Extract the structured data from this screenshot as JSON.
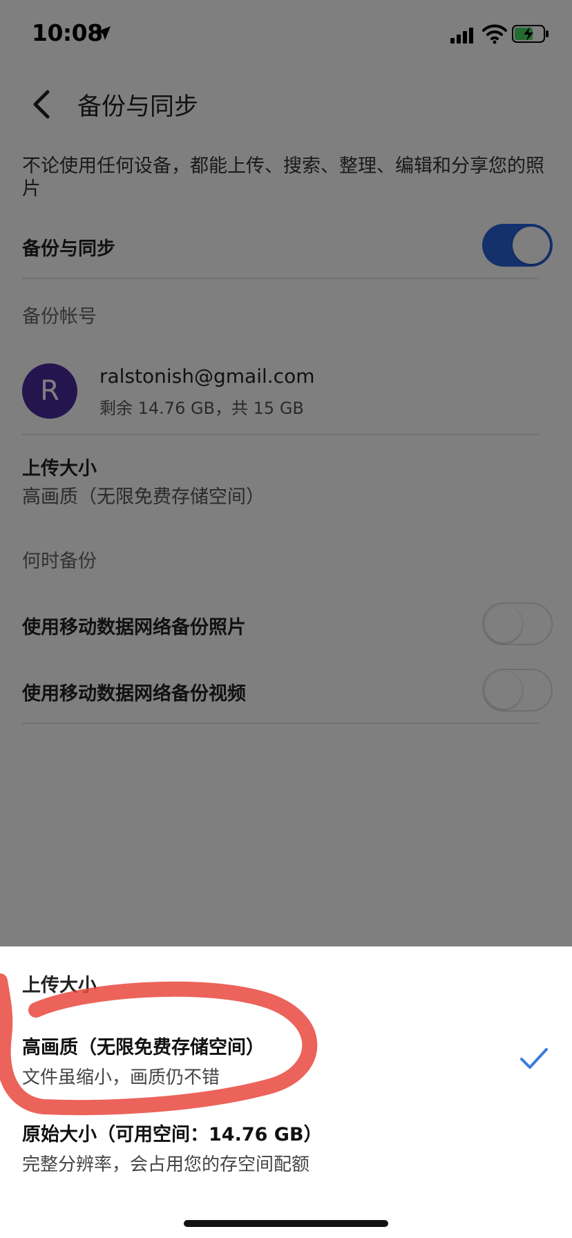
{
  "status_bar": {
    "time": "10:08"
  },
  "header": {
    "title": "备份与同步"
  },
  "description": "不论使用任何设备，都能上传、搜索、整理、编辑和分享您的照片",
  "backup_sync": {
    "label": "备份与同步",
    "enabled": true
  },
  "backup_account": {
    "section_label": "备份帐号",
    "avatar_letter": "R",
    "avatar_color": "#4a2a9e",
    "email": "ralstonish@gmail.com",
    "storage": "剩余 14.76 GB，共 15 GB"
  },
  "upload_size": {
    "label": "上传大小",
    "value": "高画质（无限免费存储空间）"
  },
  "when_backup": {
    "section_label": "何时备份",
    "photos_label": "使用移动数据网络备份照片",
    "photos_enabled": false,
    "videos_label": "使用移动数据网络备份视频",
    "videos_enabled": false
  },
  "sheet": {
    "title": "上传大小",
    "options": [
      {
        "title": "高画质（无限免费存储空间）",
        "subtitle": "文件虽缩小，画质仍不错",
        "selected": true
      },
      {
        "title": "原始大小（可用空间：14.76 GB）",
        "subtitle": "完整分辨率，会占用您的存空间配额",
        "selected": false
      }
    ]
  },
  "colors": {
    "accent": "#2962d9",
    "check": "#3a7be0",
    "annotation": "#e8483d"
  },
  "icons": [
    "back-arrow-icon",
    "location-arrow-icon",
    "signal-icon",
    "wifi-icon",
    "battery-charging-icon",
    "checkmark-icon"
  ]
}
